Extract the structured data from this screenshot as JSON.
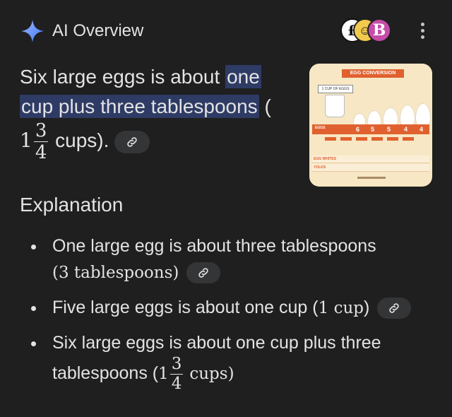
{
  "header": {
    "title": "AI Overview",
    "avatars": [
      "£",
      "☺",
      "B"
    ]
  },
  "answer": {
    "prefix": "Six large eggs is about ",
    "highlight_a": "one",
    "highlight_b": "cup plus three tablespoons",
    "after_highlight": " (",
    "whole": "1",
    "num": "3",
    "den": "4",
    "suffix": " cups)."
  },
  "thumbnail": {
    "title": "EGG CONVERSION",
    "cup_label": "1 CUP OF EGGS",
    "row_label": "EGGS",
    "counts": [
      "6",
      "5",
      "5",
      "4",
      "4"
    ],
    "table_rows": [
      "EGG WHITES",
      "YOLKS"
    ]
  },
  "explanation": {
    "heading": "Explanation",
    "b1_text": "One large egg is about three tablespoons",
    "b1_math": "(3 tablespoons)",
    "b2_text": "Five large eggs is about one cup (",
    "b2_math": "1 cup",
    "b2_close": ")",
    "b3_line1": "Six large eggs is about one cup plus three",
    "b3_pre": "tablespoons (",
    "b3_whole": "1",
    "b3_num": "3",
    "b3_den": "4",
    "b3_post": "cups)"
  },
  "colors": {
    "background": "#1f1f1f",
    "highlight": "#2e3b65",
    "chip": "#333537",
    "sparkle": "#4c8df6"
  },
  "icons": [
    "sparkle-icon",
    "more-vert-icon",
    "link-icon"
  ]
}
